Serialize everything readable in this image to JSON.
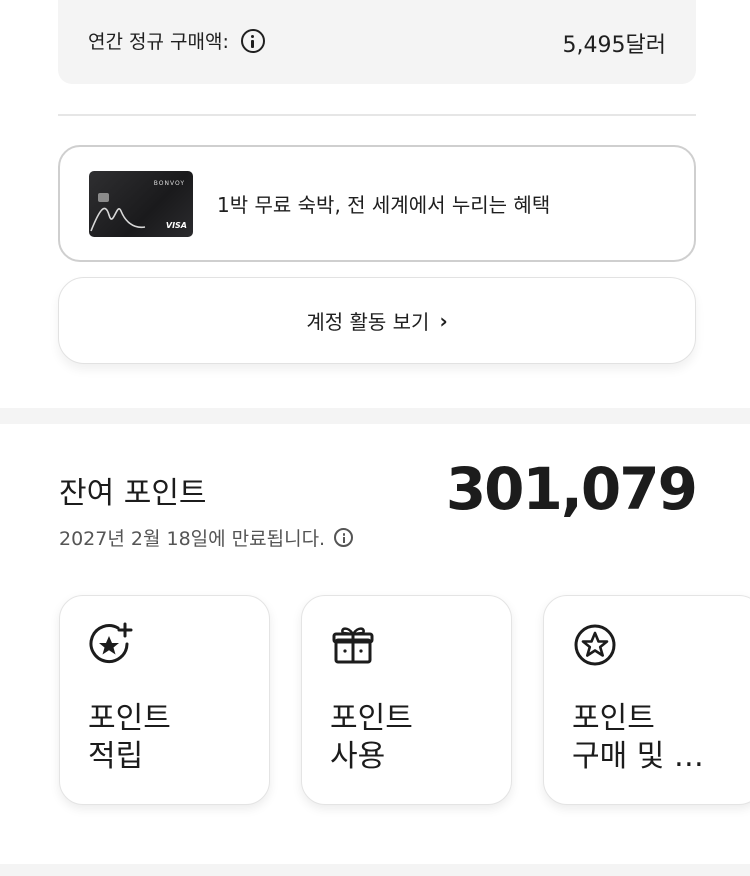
{
  "spend": {
    "label": "연간 정규 구매액:",
    "value": "5,495달러"
  },
  "card_banner": {
    "text": "1박 무료 숙박, 전 세계에서 누리는 혜택",
    "card_brand_text": "BONVOY",
    "card_network": "VISA"
  },
  "activity_button": {
    "label": "계정 활동 보기"
  },
  "points": {
    "label": "잔여 포인트",
    "value": "301,079",
    "expiry": "2027년 2월 18일에 만료됩니다."
  },
  "tiles": [
    {
      "label": "포인트\n적립",
      "icon": "star-plus-icon"
    },
    {
      "label": "포인트\n사용",
      "icon": "gift-icon"
    },
    {
      "label": "포인트\n구매 및 …",
      "icon": "star-circle-icon"
    }
  ]
}
